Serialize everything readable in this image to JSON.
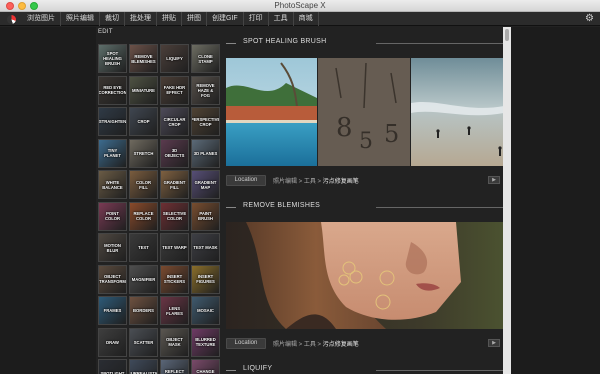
{
  "window": {
    "title": "PhotoScape X"
  },
  "menu": [
    {
      "label": "浏览图片"
    },
    {
      "label": "照片编辑"
    },
    {
      "label": "裁切"
    },
    {
      "label": "批处理"
    },
    {
      "label": "拼贴"
    },
    {
      "label": "拼图"
    },
    {
      "label": "创建GIF"
    },
    {
      "label": "打印"
    },
    {
      "label": "工具"
    },
    {
      "label": "商城"
    }
  ],
  "panel": {
    "edit_label": "EDIT"
  },
  "tools": [
    {
      "label": "SPOT HEALING BRUSH",
      "color": "#5d6e6a"
    },
    {
      "label": "REMOVE BLEMISHES",
      "color": "#6b5148"
    },
    {
      "label": "LIQUIFY",
      "color": "#4b3f3a"
    },
    {
      "label": "CLONE STAMP",
      "color": "#6d6d62"
    },
    {
      "label": "RED EYE CORRECTION",
      "color": "#3a3531"
    },
    {
      "label": "MINIATURE",
      "color": "#4e5242"
    },
    {
      "label": "FAKE HDR EFFECT",
      "color": "#4a3d35"
    },
    {
      "label": "REMOVE HAZE & FOG",
      "color": "#56504a"
    },
    {
      "label": "STRAIGHTEN",
      "color": "#2f3a46"
    },
    {
      "label": "CROP",
      "color": "#3f4650"
    },
    {
      "label": "CIRCULAR CROP",
      "color": "#4d4a58"
    },
    {
      "label": "PERSPECTIVE CROP",
      "color": "#4f4233"
    },
    {
      "label": "TINY PLANET",
      "color": "#3c6b8e"
    },
    {
      "label": "STRETCH",
      "color": "#6f6a5f"
    },
    {
      "label": "3D OBJECTS",
      "color": "#5a3a4e"
    },
    {
      "label": "3D PLANES",
      "color": "#5b6a78"
    },
    {
      "label": "WHITE BALANCE",
      "color": "#6a5b45"
    },
    {
      "label": "COLOR FILL",
      "color": "#7a5c3e"
    },
    {
      "label": "GRADIENT FILL",
      "color": "#7e6040"
    },
    {
      "label": "GRADIENT MAP",
      "color": "#564e76"
    },
    {
      "label": "POINT COLOR",
      "color": "#7a3a54"
    },
    {
      "label": "REPLACE COLOR",
      "color": "#8a4a2a"
    },
    {
      "label": "SELECTIVE COLOR",
      "color": "#6e2f33"
    },
    {
      "label": "PAINT BRUSH",
      "color": "#784d2f"
    },
    {
      "label": "MOTION BLUR",
      "color": "#4e4740"
    },
    {
      "label": "TEXT",
      "color": "#3a3a3a"
    },
    {
      "label": "TEXT WARP",
      "color": "#3c3c3c"
    },
    {
      "label": "TEXT MASK",
      "color": "#3e3f45"
    },
    {
      "label": "OBJECT TRANSFORM",
      "color": "#5a4a3d"
    },
    {
      "label": "MAGNIFIER",
      "color": "#4e4e4e"
    },
    {
      "label": "INSERT STICKERS",
      "color": "#7a4a2f"
    },
    {
      "label": "INSERT FIGURES",
      "color": "#8a6e2a"
    },
    {
      "label": "FRAMES",
      "color": "#2d5a78"
    },
    {
      "label": "BORDERS",
      "color": "#6e5140"
    },
    {
      "label": "LENS FLARES",
      "color": "#6a3545"
    },
    {
      "label": "MOSAIC",
      "color": "#3f5a6e"
    },
    {
      "label": "DRAW",
      "color": "#3e3e3e"
    },
    {
      "label": "SCATTER",
      "color": "#4a4e54"
    },
    {
      "label": "OBJECT MASK",
      "color": "#5a5650"
    },
    {
      "label": "BLURRED TEXTURE",
      "color": "#6e3a64"
    },
    {
      "label": "SPOTLIGHT",
      "color": "#2a2d33"
    },
    {
      "label": "SURREALISTIC",
      "color": "#3f4a5a"
    },
    {
      "label": "REFLECT IMAGE",
      "color": "#5a6678"
    },
    {
      "label": "CHANGE BACKGROUND",
      "color": "#7a4a6a"
    }
  ],
  "sections": [
    {
      "title": "SPOT HEALING BRUSH",
      "location_button": "Location",
      "path_prefix": "照片编辑 > 工具 >",
      "path_name": "污点修复画笔"
    },
    {
      "title": "REMOVE BLEMISHES",
      "location_button": "Location",
      "path_prefix": "照片编辑 > 工具 >",
      "path_name": "污点修复画笔"
    },
    {
      "title": "LIQUIFY"
    }
  ],
  "play_button": "▶",
  "settings_icon": "⚙"
}
